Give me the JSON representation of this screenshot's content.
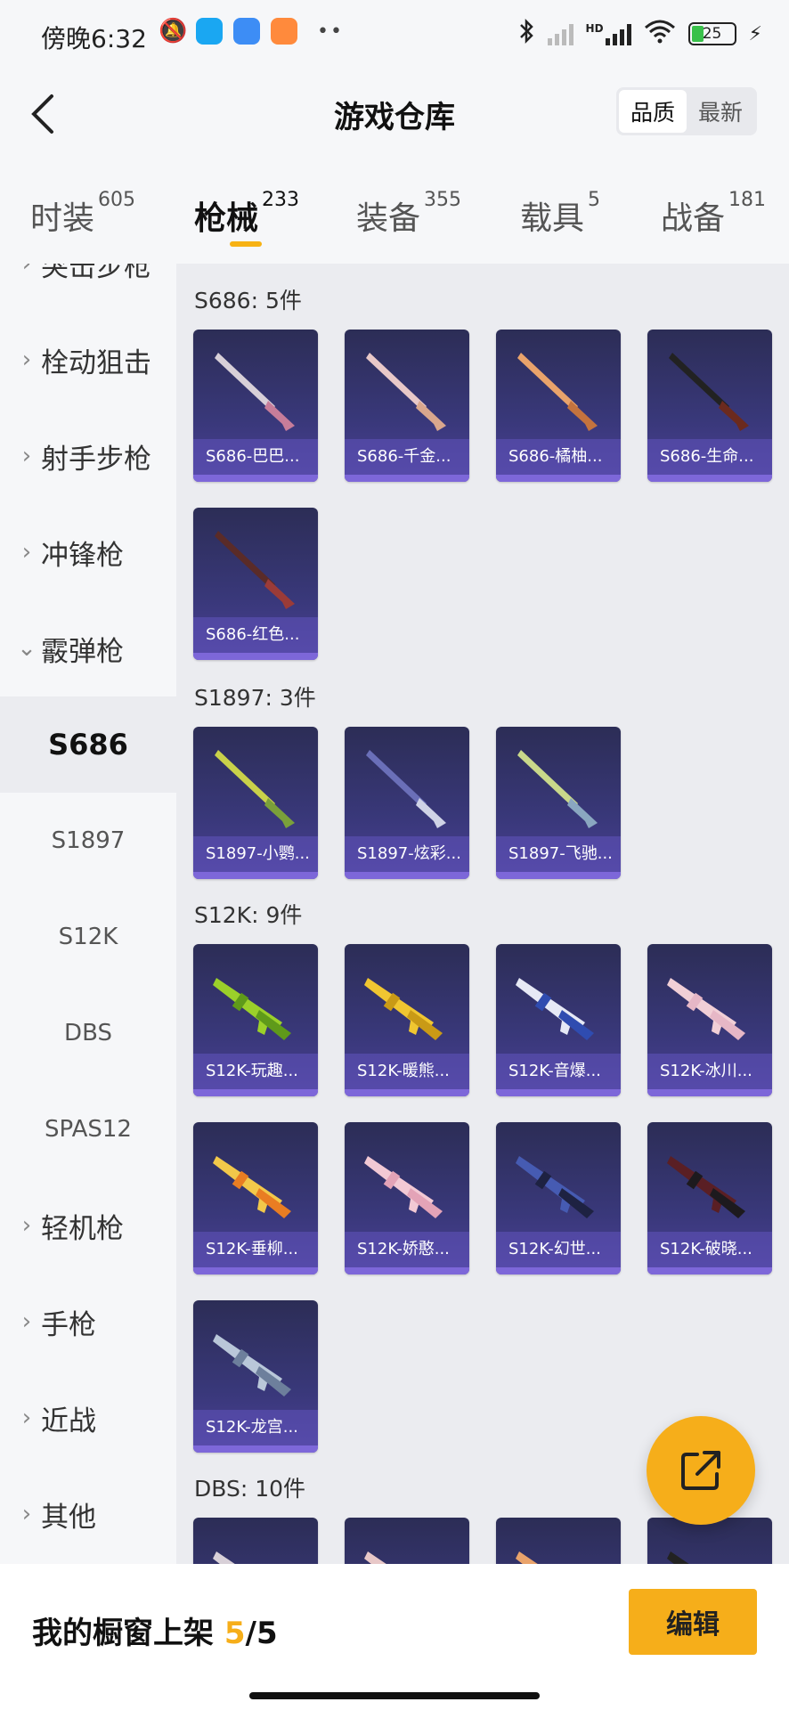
{
  "status_bar": {
    "time": "傍晚6:32",
    "battery": "25",
    "hd": "HD"
  },
  "header": {
    "title": "游戏仓库",
    "sort_options": [
      {
        "label": "品质",
        "active": true
      },
      {
        "label": "最新",
        "active": false
      }
    ]
  },
  "tabs": [
    {
      "label": "时装",
      "count": "605",
      "active": false
    },
    {
      "label": "枪械",
      "count": "233",
      "active": true
    },
    {
      "label": "装备",
      "count": "355",
      "active": false
    },
    {
      "label": "载具",
      "count": "5",
      "active": false
    },
    {
      "label": "战备",
      "count": "181",
      "active": false
    }
  ],
  "sidebar": {
    "categories": [
      {
        "label": "突击步枪",
        "expanded": false
      },
      {
        "label": "栓动狙击",
        "expanded": false
      },
      {
        "label": "射手步枪",
        "expanded": false
      },
      {
        "label": "冲锋枪",
        "expanded": false
      },
      {
        "label": "霰弹枪",
        "expanded": true
      }
    ],
    "subcategories": [
      {
        "label": "S686",
        "active": true
      },
      {
        "label": "S1897",
        "active": false
      },
      {
        "label": "S12K",
        "active": false
      },
      {
        "label": "DBS",
        "active": false
      },
      {
        "label": "SPAS12",
        "active": false
      }
    ],
    "more_categories": [
      {
        "label": "轻机枪"
      },
      {
        "label": "手枪"
      },
      {
        "label": "近战"
      },
      {
        "label": "其他"
      }
    ]
  },
  "sections": [
    {
      "label": "S686: 5件",
      "items": [
        "S686-巴巴...",
        "S686-千金...",
        "S686-橘柚...",
        "S686-生命...",
        "S686-红色..."
      ]
    },
    {
      "label": "S1897: 3件",
      "items": [
        "S1897-小鹦...",
        "S1897-炫彩...",
        "S1897-飞驰..."
      ]
    },
    {
      "label": "S12K: 9件",
      "items": [
        "S12K-玩趣...",
        "S12K-暖熊...",
        "S12K-音爆...",
        "S12K-冰川...",
        "S12K-垂柳...",
        "S12K-娇憨...",
        "S12K-幻世...",
        "S12K-破晓...",
        "S12K-龙宫..."
      ]
    },
    {
      "label": "DBS: 10件",
      "items": []
    }
  ],
  "bottom_bar": {
    "label": "我的橱窗上架",
    "count_current": "5",
    "count_sep": "/",
    "count_total": "5",
    "edit_label": "编辑"
  },
  "colors": {
    "accent": "#f6ae1a",
    "card_top": "#2c2d56",
    "card_bottom": "#4b3f95",
    "quality_bar": "#7d67d9"
  }
}
